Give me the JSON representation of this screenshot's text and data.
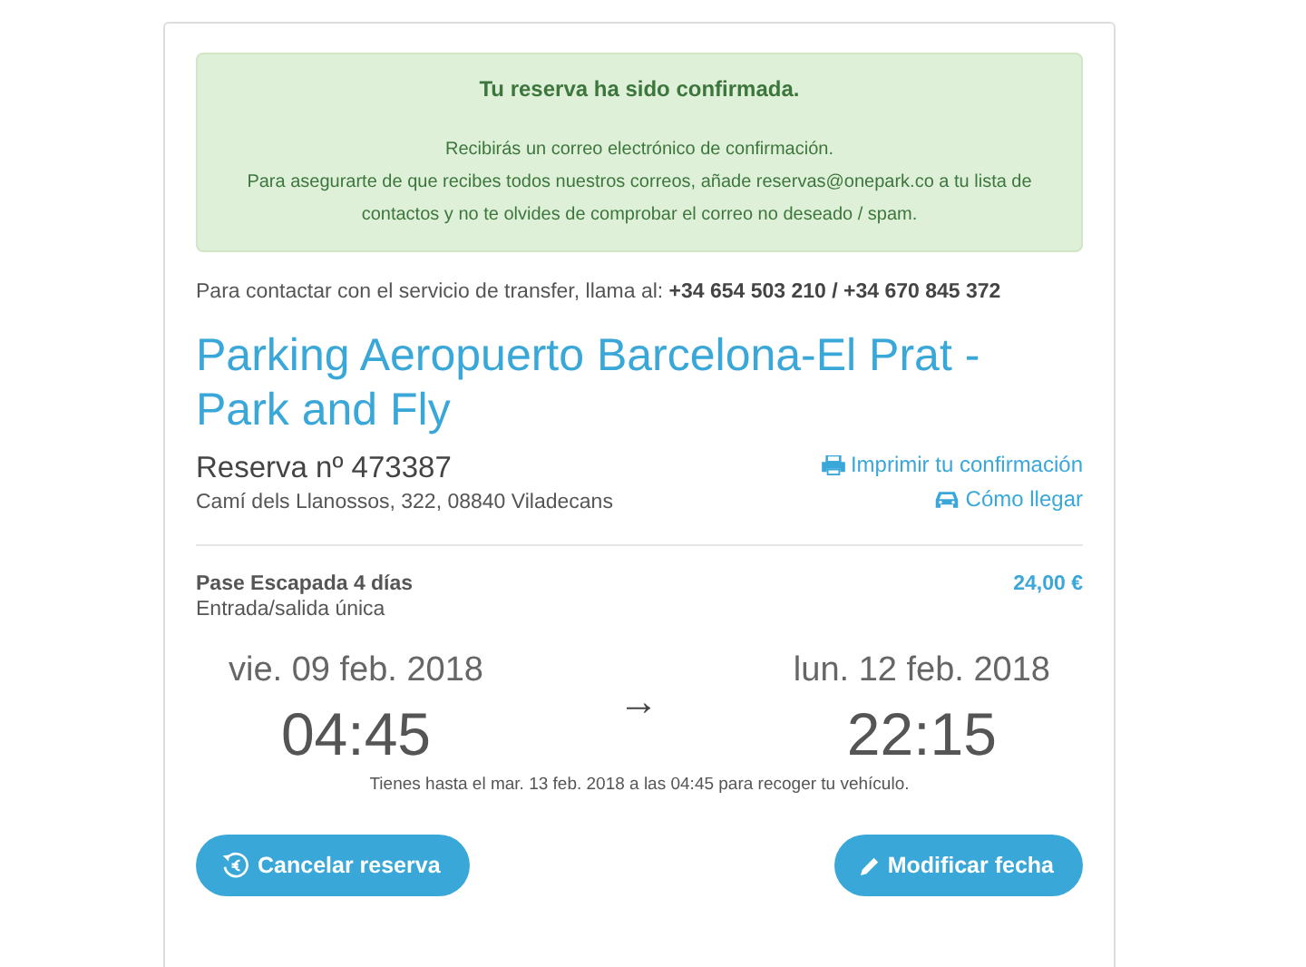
{
  "alert": {
    "title": "Tu reserva ha sido confirmada.",
    "lines": [
      "Recibirás un correo electrónico de confirmación.",
      "Para asegurarte de que recibes todos nuestros correos, añade reservas@onepark.co a tu lista de contactos y no te olvides de comprobar el correo no deseado / spam."
    ]
  },
  "contact": "Para contactar con el servicio de transfer, llama al: **+34 654 503 210 / +34 670 845 372**",
  "parking_name": "Parking Aeropuerto Barcelona-El Prat - Park and Fly",
  "booking_number": "Reserva nº 473387",
  "address": "Camí dels Llanossos, 322, 08840 Viladecans",
  "links": [
    {
      "kind": "print",
      "label": "Imprimir tu confirmación"
    },
    {
      "kind": "car",
      "label": "Cómo llegar"
    }
  ],
  "product": {
    "name": "Pase Escapada 4 días",
    "detail": "Entrada/salida única",
    "price": "24,00 €"
  },
  "start": {
    "date": "vie. 09 feb. 2018",
    "time": "04:45"
  },
  "arrow": "→",
  "end": {
    "date": "lun. 12 feb. 2018",
    "time": "22:15"
  },
  "note": "Tienes hasta el mar. 13 feb. 2018 a las 04:45 para recoger tu vehículo.",
  "buttons": [
    {
      "kind": "cancel",
      "label": "Cancelar reserva"
    },
    {
      "kind": "edit",
      "label": "Modificar fecha"
    }
  ]
}
